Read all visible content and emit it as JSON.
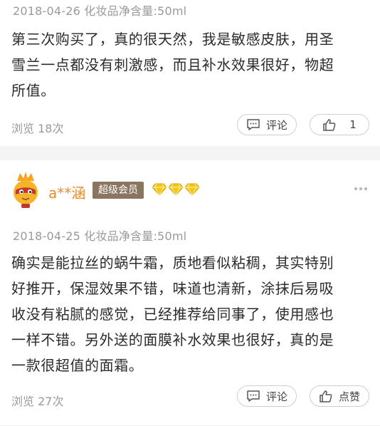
{
  "reviews": [
    {
      "meta": "2018-04-26 化妆品净含量:50ml",
      "lines": [
        "第三次购买了，真的很天然，我是敏感皮肤，用圣",
        "雪兰一点都没有刺激感，而且补水效果很好，物超",
        "所值。"
      ],
      "views": "浏览 18次",
      "comment_label": "评论",
      "like_label": "1"
    },
    {
      "username": "a**涵",
      "badge": "超级会员",
      "meta": "2018-04-25 化妆品净含量:50ml",
      "lines": [
        "确实是能拉丝的蜗牛霜，质地看似粘稠，其实特别",
        "好推开，保湿效果不错，味道也清新，涂抹后易吸",
        "收没有粘腻的感觉，已经推荐给同事了，使用感也",
        "一样不错。另外送的面膜补水效果也很好，真的是",
        "一款很超值的面霜。"
      ],
      "views": "浏览 27次",
      "comment_label": "评论",
      "like_label": "点赞"
    }
  ],
  "colors": {
    "username": "#e98a2a",
    "badge_bg": "#8a7560",
    "gem": "#f5c518",
    "divider": "#f4f4f4"
  },
  "icons": [
    "comment-icon",
    "thumbs-up-icon",
    "diamond-icon",
    "more-dots-icon",
    "avatar-mascot"
  ]
}
